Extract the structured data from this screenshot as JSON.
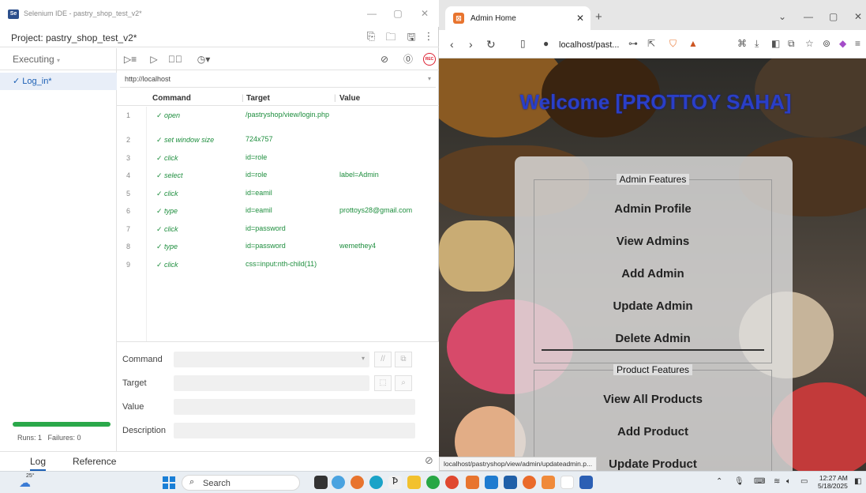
{
  "ide": {
    "window_title": "Selenium IDE - pastry_shop_test_v2*",
    "app_icon_text": "Se",
    "project": "Project: pastry_shop_test_v2*",
    "mode": "Executing",
    "test_name": "✓ Log_in*",
    "base_url": "http://localhost",
    "columns": {
      "command": "Command",
      "target": "Target",
      "value": "Value"
    },
    "commands": [
      {
        "num": "1",
        "command": "✓ open",
        "target": "/pastryshop/view/login.php",
        "value": ""
      },
      {
        "num": "2",
        "command": "✓ set window size",
        "target": "724x757",
        "value": ""
      },
      {
        "num": "3",
        "command": "✓ click",
        "target": "id=role",
        "value": ""
      },
      {
        "num": "4",
        "command": "✓ select",
        "target": "id=role",
        "value": "label=Admin"
      },
      {
        "num": "5",
        "command": "✓ click",
        "target": "id=eamil",
        "value": ""
      },
      {
        "num": "6",
        "command": "✓ type",
        "target": "id=eamil",
        "value": "prottoys28@gmail.com"
      },
      {
        "num": "7",
        "command": "✓ click",
        "target": "id=password",
        "value": ""
      },
      {
        "num": "8",
        "command": "✓ type",
        "target": "id=password",
        "value": "wemethey4"
      },
      {
        "num": "9",
        "command": "✓ click",
        "target": "css=input:nth-child(11)",
        "value": ""
      }
    ],
    "editor": {
      "command": "Command",
      "target": "Target",
      "value": "Value",
      "description": "Description"
    },
    "runs": "Runs: 1",
    "failures": "Failures: 0",
    "tabs": {
      "log": "Log",
      "reference": "Reference"
    },
    "status_colors": {
      "pass": "#1e8e3e",
      "progress": "#2aa84a",
      "record": "#dd2233"
    }
  },
  "browser": {
    "tab_title": "Admin Home",
    "favicon_text": "⊠",
    "address": "localhost/past...",
    "welcome": "Welcome [PROTTOY SAHA]",
    "admin_features": {
      "legend": "Admin Features",
      "items": [
        "Admin Profile",
        "View Admins",
        "Add Admin",
        "Update Admin",
        "Delete Admin"
      ]
    },
    "product_features": {
      "legend": "Product Features",
      "items": [
        "View All Products",
        "Add Product",
        "Update Product"
      ]
    },
    "status_url": "localhost/pastryshop/view/admin/updateadmin.p...",
    "welcome_color": "#2a3fc8"
  },
  "taskbar": {
    "temperature": "25°",
    "search_label": "Search",
    "time": "12:27 AM",
    "date": "5/18/2025"
  }
}
